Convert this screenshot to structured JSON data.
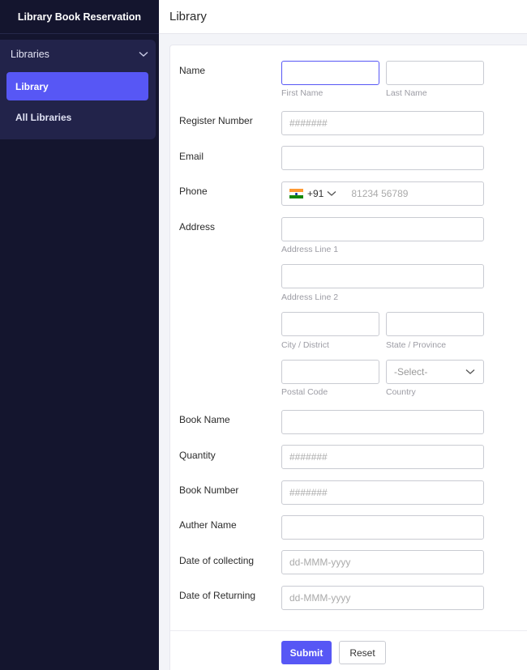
{
  "sidebar": {
    "brand": "Library Book Reservation",
    "group_label": "Libraries",
    "items": [
      {
        "label": "Library",
        "active": true
      },
      {
        "label": "All Libraries",
        "active": false
      }
    ]
  },
  "header": {
    "title": "Library"
  },
  "form": {
    "name": {
      "label": "Name",
      "first_hint": "First Name",
      "last_hint": "Last Name",
      "first_value": "",
      "last_value": ""
    },
    "register": {
      "label": "Register Number",
      "placeholder": "#######"
    },
    "email": {
      "label": "Email",
      "value": ""
    },
    "phone": {
      "label": "Phone",
      "country_code": "+91",
      "placeholder": "81234 56789"
    },
    "address": {
      "label": "Address",
      "line1_hint": "Address Line 1",
      "line2_hint": "Address Line 2",
      "city_hint": "City / District",
      "state_hint": "State / Province",
      "postal_hint": "Postal Code",
      "country_hint": "Country",
      "country_select": "-Select-"
    },
    "book_name": {
      "label": "Book Name",
      "value": ""
    },
    "quantity": {
      "label": "Quantity",
      "placeholder": "#######"
    },
    "book_number": {
      "label": "Book Number",
      "placeholder": "#######"
    },
    "author": {
      "label": "Auther Name",
      "value": ""
    },
    "date_collect": {
      "label": "Date of collecting",
      "placeholder": "dd-MMM-yyyy"
    },
    "date_return": {
      "label": "Date of Returning",
      "placeholder": "dd-MMM-yyyy"
    }
  },
  "buttons": {
    "submit": "Submit",
    "reset": "Reset"
  },
  "colors": {
    "accent": "#5757f5",
    "sidebar_bg": "#14152e",
    "sidebar_group_bg": "#22234a"
  }
}
